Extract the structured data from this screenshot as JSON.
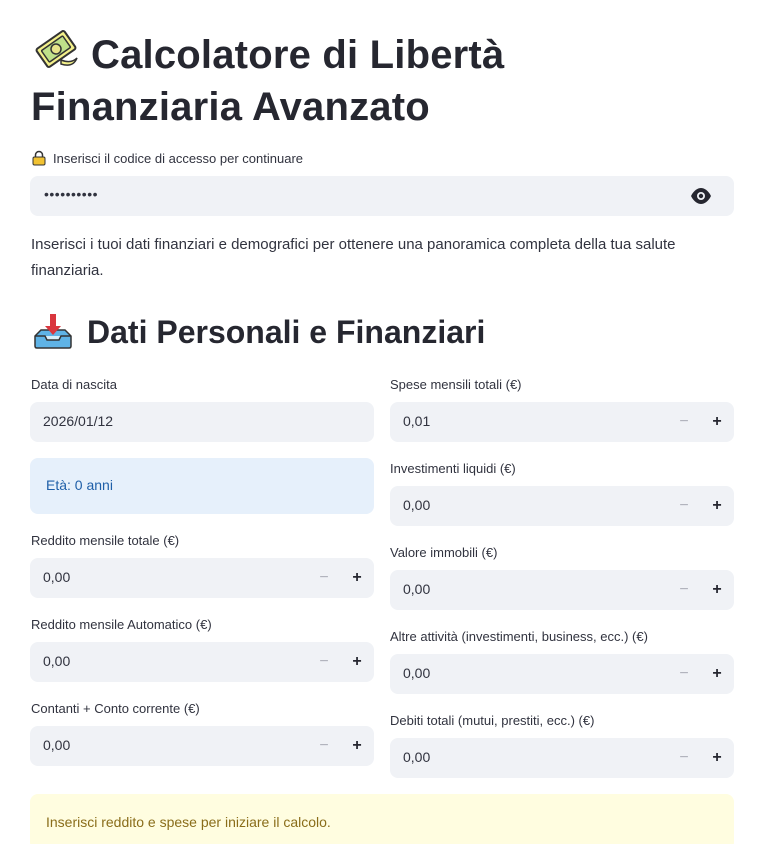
{
  "header": {
    "title_line1": "Calcolatore di Libertà",
    "title_line2": "Finanziaria Avanzato"
  },
  "access": {
    "label": "Inserisci il codice di accesso per continuare",
    "value": "••••••••••"
  },
  "intro": "Inserisci i tuoi dati finanziari e demografici per ottenere una panoramica completa della tua salute finanziaria.",
  "section": {
    "title": "Dati Personali e Finanziari"
  },
  "left": {
    "birth_label": "Data di nascita",
    "birth_value": "2026/01/12",
    "age_info": "Età: 0 anni",
    "income_label": "Reddito mensile totale (€)",
    "income_value": "0,00",
    "auto_income_label": "Reddito mensile Automatico (€)",
    "auto_income_value": "0,00",
    "cash_label": "Contanti + Conto corrente (€)",
    "cash_value": "0,00"
  },
  "right": {
    "expenses_label": "Spese mensili totali (€)",
    "expenses_value": "0,01",
    "liquid_label": "Investimenti liquidi (€)",
    "liquid_value": "0,00",
    "realestate_label": "Valore immobili (€)",
    "realestate_value": "0,00",
    "other_label": "Altre attività (investimenti, business, ecc.) (€)",
    "other_value": "0,00",
    "debt_label": "Debiti totali (mutui, prestiti, ecc.) (€)",
    "debt_value": "0,00"
  },
  "stepper": {
    "minus": "−",
    "plus": "+"
  },
  "warning": "Inserisci reddito e spese per iniziare il calcolo.",
  "colors": {
    "input_bg": "#f0f2f6",
    "info_bg": "#e6f0fb",
    "info_text": "#1f5fa8",
    "warn_bg": "#fffde0",
    "warn_text": "#8a6d1a"
  }
}
